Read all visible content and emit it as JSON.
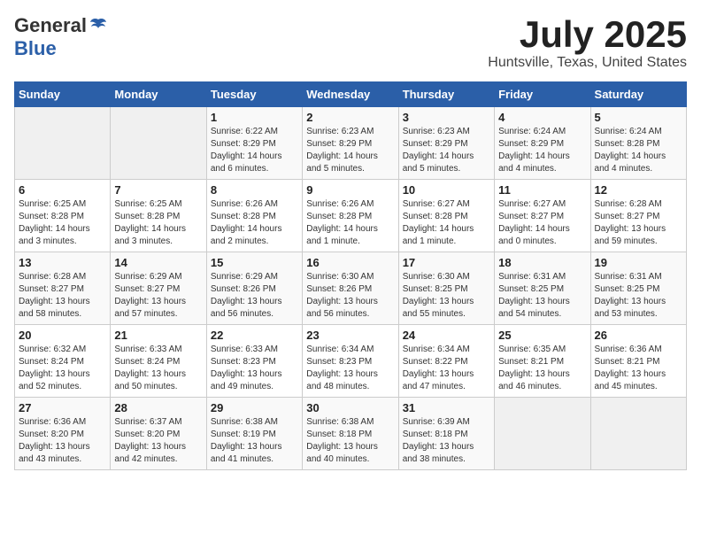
{
  "header": {
    "logo_general": "General",
    "logo_blue": "Blue",
    "month_title": "July 2025",
    "location": "Huntsville, Texas, United States"
  },
  "days_of_week": [
    "Sunday",
    "Monday",
    "Tuesday",
    "Wednesday",
    "Thursday",
    "Friday",
    "Saturday"
  ],
  "weeks": [
    [
      {
        "day": "",
        "info": ""
      },
      {
        "day": "",
        "info": ""
      },
      {
        "day": "1",
        "info": "Sunrise: 6:22 AM\nSunset: 8:29 PM\nDaylight: 14 hours\nand 6 minutes."
      },
      {
        "day": "2",
        "info": "Sunrise: 6:23 AM\nSunset: 8:29 PM\nDaylight: 14 hours\nand 5 minutes."
      },
      {
        "day": "3",
        "info": "Sunrise: 6:23 AM\nSunset: 8:29 PM\nDaylight: 14 hours\nand 5 minutes."
      },
      {
        "day": "4",
        "info": "Sunrise: 6:24 AM\nSunset: 8:29 PM\nDaylight: 14 hours\nand 4 minutes."
      },
      {
        "day": "5",
        "info": "Sunrise: 6:24 AM\nSunset: 8:28 PM\nDaylight: 14 hours\nand 4 minutes."
      }
    ],
    [
      {
        "day": "6",
        "info": "Sunrise: 6:25 AM\nSunset: 8:28 PM\nDaylight: 14 hours\nand 3 minutes."
      },
      {
        "day": "7",
        "info": "Sunrise: 6:25 AM\nSunset: 8:28 PM\nDaylight: 14 hours\nand 3 minutes."
      },
      {
        "day": "8",
        "info": "Sunrise: 6:26 AM\nSunset: 8:28 PM\nDaylight: 14 hours\nand 2 minutes."
      },
      {
        "day": "9",
        "info": "Sunrise: 6:26 AM\nSunset: 8:28 PM\nDaylight: 14 hours\nand 1 minute."
      },
      {
        "day": "10",
        "info": "Sunrise: 6:27 AM\nSunset: 8:28 PM\nDaylight: 14 hours\nand 1 minute."
      },
      {
        "day": "11",
        "info": "Sunrise: 6:27 AM\nSunset: 8:27 PM\nDaylight: 14 hours\nand 0 minutes."
      },
      {
        "day": "12",
        "info": "Sunrise: 6:28 AM\nSunset: 8:27 PM\nDaylight: 13 hours\nand 59 minutes."
      }
    ],
    [
      {
        "day": "13",
        "info": "Sunrise: 6:28 AM\nSunset: 8:27 PM\nDaylight: 13 hours\nand 58 minutes."
      },
      {
        "day": "14",
        "info": "Sunrise: 6:29 AM\nSunset: 8:27 PM\nDaylight: 13 hours\nand 57 minutes."
      },
      {
        "day": "15",
        "info": "Sunrise: 6:29 AM\nSunset: 8:26 PM\nDaylight: 13 hours\nand 56 minutes."
      },
      {
        "day": "16",
        "info": "Sunrise: 6:30 AM\nSunset: 8:26 PM\nDaylight: 13 hours\nand 56 minutes."
      },
      {
        "day": "17",
        "info": "Sunrise: 6:30 AM\nSunset: 8:25 PM\nDaylight: 13 hours\nand 55 minutes."
      },
      {
        "day": "18",
        "info": "Sunrise: 6:31 AM\nSunset: 8:25 PM\nDaylight: 13 hours\nand 54 minutes."
      },
      {
        "day": "19",
        "info": "Sunrise: 6:31 AM\nSunset: 8:25 PM\nDaylight: 13 hours\nand 53 minutes."
      }
    ],
    [
      {
        "day": "20",
        "info": "Sunrise: 6:32 AM\nSunset: 8:24 PM\nDaylight: 13 hours\nand 52 minutes."
      },
      {
        "day": "21",
        "info": "Sunrise: 6:33 AM\nSunset: 8:24 PM\nDaylight: 13 hours\nand 50 minutes."
      },
      {
        "day": "22",
        "info": "Sunrise: 6:33 AM\nSunset: 8:23 PM\nDaylight: 13 hours\nand 49 minutes."
      },
      {
        "day": "23",
        "info": "Sunrise: 6:34 AM\nSunset: 8:23 PM\nDaylight: 13 hours\nand 48 minutes."
      },
      {
        "day": "24",
        "info": "Sunrise: 6:34 AM\nSunset: 8:22 PM\nDaylight: 13 hours\nand 47 minutes."
      },
      {
        "day": "25",
        "info": "Sunrise: 6:35 AM\nSunset: 8:21 PM\nDaylight: 13 hours\nand 46 minutes."
      },
      {
        "day": "26",
        "info": "Sunrise: 6:36 AM\nSunset: 8:21 PM\nDaylight: 13 hours\nand 45 minutes."
      }
    ],
    [
      {
        "day": "27",
        "info": "Sunrise: 6:36 AM\nSunset: 8:20 PM\nDaylight: 13 hours\nand 43 minutes."
      },
      {
        "day": "28",
        "info": "Sunrise: 6:37 AM\nSunset: 8:20 PM\nDaylight: 13 hours\nand 42 minutes."
      },
      {
        "day": "29",
        "info": "Sunrise: 6:38 AM\nSunset: 8:19 PM\nDaylight: 13 hours\nand 41 minutes."
      },
      {
        "day": "30",
        "info": "Sunrise: 6:38 AM\nSunset: 8:18 PM\nDaylight: 13 hours\nand 40 minutes."
      },
      {
        "day": "31",
        "info": "Sunrise: 6:39 AM\nSunset: 8:18 PM\nDaylight: 13 hours\nand 38 minutes."
      },
      {
        "day": "",
        "info": ""
      },
      {
        "day": "",
        "info": ""
      }
    ]
  ]
}
